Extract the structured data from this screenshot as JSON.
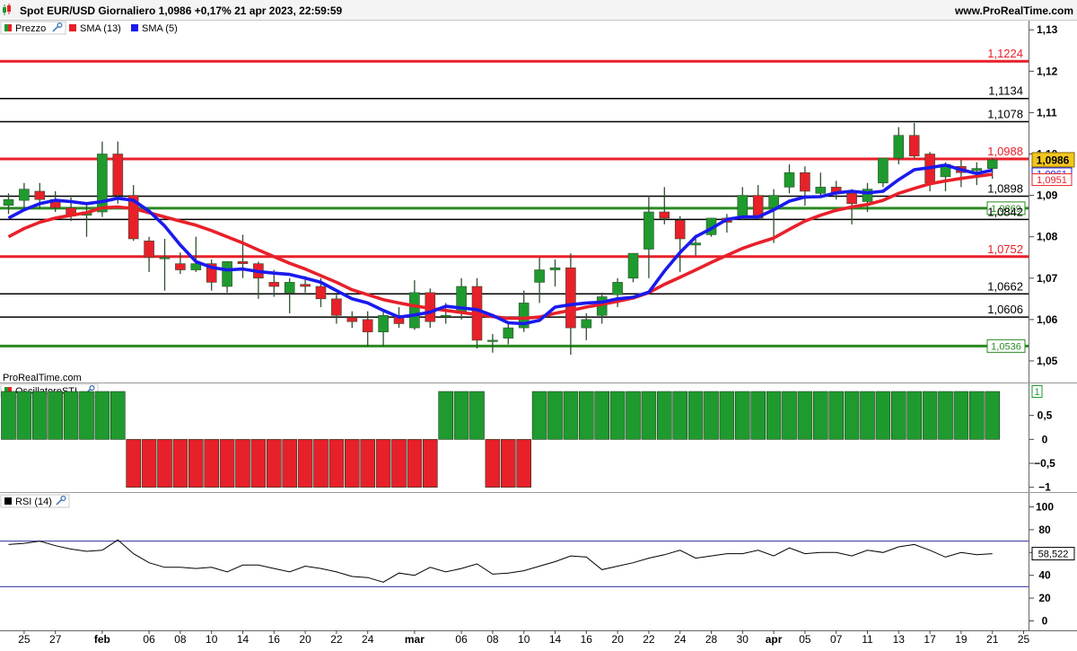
{
  "header": {
    "title": "Spot EUR/USD Giornaliero 1,0986 +0,17% 21 apr 2023, 22:59:59",
    "brand": "www.ProRealTime.com"
  },
  "legend": {
    "price": "Prezzo",
    "sma13": "SMA (13)",
    "sma5": "SMA (5)"
  },
  "watermark": "ProRealTime.com",
  "colors": {
    "bull": "#1f9a2e",
    "bear": "#e8202a",
    "sma13": "#e8202a",
    "sma5": "#1a1aee",
    "hline_red": "#e8202a",
    "hline_black": "#000000",
    "hline_green": "#2a8a20",
    "current": "#f2c61f"
  },
  "dates": [
    "2023-01-24",
    "2023-01-25",
    "2023-01-26",
    "2023-01-27",
    "2023-01-30",
    "2023-01-31",
    "2023-02-01",
    "2023-02-02",
    "2023-02-03",
    "2023-02-06",
    "2023-02-07",
    "2023-02-08",
    "2023-02-09",
    "2023-02-10",
    "2023-02-13",
    "2023-02-14",
    "2023-02-15",
    "2023-02-16",
    "2023-02-17",
    "2023-02-20",
    "2023-02-21",
    "2023-02-22",
    "2023-02-23",
    "2023-02-24",
    "2023-02-27",
    "2023-02-28",
    "2023-03-01",
    "2023-03-02",
    "2023-03-03",
    "2023-03-06",
    "2023-03-07",
    "2023-03-08",
    "2023-03-09",
    "2023-03-10",
    "2023-03-13",
    "2023-03-14",
    "2023-03-15",
    "2023-03-16",
    "2023-03-17",
    "2023-03-20",
    "2023-03-21",
    "2023-03-22",
    "2023-03-23",
    "2023-03-24",
    "2023-03-27",
    "2023-03-28",
    "2023-03-29",
    "2023-03-30",
    "2023-03-31",
    "2023-04-03",
    "2023-04-04",
    "2023-04-05",
    "2023-04-06",
    "2023-04-07",
    "2023-04-10",
    "2023-04-11",
    "2023-04-12",
    "2023-04-13",
    "2023-04-14",
    "2023-04-17",
    "2023-04-18",
    "2023-04-19",
    "2023-04-20",
    "2023-04-21"
  ],
  "x_labels": [
    {
      "date": "2023-01-25",
      "text": "25",
      "bold": false
    },
    {
      "date": "2023-01-27",
      "text": "27",
      "bold": false
    },
    {
      "date": "2023-02-01",
      "text": "feb",
      "bold": true
    },
    {
      "date": "2023-02-06",
      "text": "06",
      "bold": false
    },
    {
      "date": "2023-02-08",
      "text": "08",
      "bold": false
    },
    {
      "date": "2023-02-10",
      "text": "10",
      "bold": false
    },
    {
      "date": "2023-02-14",
      "text": "14",
      "bold": false
    },
    {
      "date": "2023-02-16",
      "text": "16",
      "bold": false
    },
    {
      "date": "2023-02-20",
      "text": "20",
      "bold": false
    },
    {
      "date": "2023-02-22",
      "text": "22",
      "bold": false
    },
    {
      "date": "2023-02-24",
      "text": "24",
      "bold": false
    },
    {
      "date": "2023-03-01",
      "text": "mar",
      "bold": true
    },
    {
      "date": "2023-03-06",
      "text": "06",
      "bold": false
    },
    {
      "date": "2023-03-08",
      "text": "08",
      "bold": false
    },
    {
      "date": "2023-03-10",
      "text": "10",
      "bold": false
    },
    {
      "date": "2023-03-14",
      "text": "14",
      "bold": false
    },
    {
      "date": "2023-03-16",
      "text": "16",
      "bold": false
    },
    {
      "date": "2023-03-20",
      "text": "20",
      "bold": false
    },
    {
      "date": "2023-03-22",
      "text": "22",
      "bold": false
    },
    {
      "date": "2023-03-24",
      "text": "24",
      "bold": false
    },
    {
      "date": "2023-03-28",
      "text": "28",
      "bold": false
    },
    {
      "date": "2023-03-30",
      "text": "30",
      "bold": false
    },
    {
      "date": "2023-04-03",
      "text": "apr",
      "bold": true
    },
    {
      "date": "2023-04-05",
      "text": "05",
      "bold": false
    },
    {
      "date": "2023-04-07",
      "text": "07",
      "bold": false
    },
    {
      "date": "2023-04-11",
      "text": "11",
      "bold": false
    },
    {
      "date": "2023-04-13",
      "text": "13",
      "bold": false
    },
    {
      "date": "2023-04-17",
      "text": "17",
      "bold": false
    },
    {
      "date": "2023-04-19",
      "text": "19",
      "bold": false
    },
    {
      "date": "2023-04-21",
      "text": "21",
      "bold": false
    },
    {
      "date": "2023-04-25",
      "text": "25",
      "bold": false
    }
  ],
  "chart_data": [
    {
      "type": "candlestick",
      "name": "Spot EUR/USD Giornaliero",
      "ylim": [
        1.045,
        1.132
      ],
      "y_ticks": [
        "1,05",
        "1,06",
        "1,07",
        "1,08",
        "1,09",
        "1,10",
        "1,11",
        "1,12",
        "1,13"
      ],
      "ohlc": [
        [
          1.0876,
          1.0905,
          1.0855,
          1.089
        ],
        [
          1.0888,
          1.093,
          1.0868,
          1.0915
        ],
        [
          1.091,
          1.093,
          1.0868,
          1.089
        ],
        [
          1.089,
          1.091,
          1.086,
          1.087
        ],
        [
          1.087,
          1.0895,
          1.0838,
          1.085
        ],
        [
          1.0852,
          1.0882,
          1.08,
          1.086
        ],
        [
          1.086,
          1.103,
          1.0848,
          1.1
        ],
        [
          1.1,
          1.103,
          1.088,
          1.09
        ],
        [
          1.09,
          1.0925,
          1.079,
          1.0795
        ],
        [
          1.079,
          1.08,
          1.0715,
          1.075
        ],
        [
          1.075,
          1.0795,
          1.067,
          1.075
        ],
        [
          1.0735,
          1.0762,
          1.071,
          1.072
        ],
        [
          1.072,
          1.08,
          1.0715,
          1.0735
        ],
        [
          1.0735,
          1.0745,
          1.067,
          1.069
        ],
        [
          1.068,
          1.074,
          1.0665,
          1.074
        ],
        [
          1.074,
          1.0805,
          1.07,
          1.0735
        ],
        [
          1.0735,
          1.074,
          1.065,
          1.07
        ],
        [
          1.069,
          1.072,
          1.0655,
          1.068
        ],
        [
          1.0665,
          1.07,
          1.0615,
          1.069
        ],
        [
          1.0685,
          1.0705,
          1.0665,
          1.068
        ],
        [
          1.068,
          1.07,
          1.063,
          1.065
        ],
        [
          1.065,
          1.066,
          1.059,
          1.061
        ],
        [
          1.0605,
          1.062,
          1.058,
          1.0595
        ],
        [
          1.06,
          1.062,
          1.0535,
          1.057
        ],
        [
          1.057,
          1.062,
          1.0535,
          1.061
        ],
        [
          1.061,
          1.063,
          1.058,
          1.059
        ],
        [
          1.058,
          1.0695,
          1.0575,
          1.0665
        ],
        [
          1.0665,
          1.0675,
          1.058,
          1.0595
        ],
        [
          1.061,
          1.064,
          1.059,
          1.061
        ],
        [
          1.062,
          1.07,
          1.06,
          1.068
        ],
        [
          1.068,
          1.07,
          1.053,
          1.055
        ],
        [
          1.055,
          1.0565,
          1.052,
          1.055
        ],
        [
          1.0555,
          1.059,
          1.054,
          1.058
        ],
        [
          1.058,
          1.067,
          1.057,
          1.064
        ],
        [
          1.069,
          1.075,
          1.064,
          1.072
        ],
        [
          1.072,
          1.0745,
          1.068,
          1.0725
        ],
        [
          1.0725,
          1.076,
          1.0515,
          1.058
        ],
        [
          1.058,
          1.0615,
          1.055,
          1.06
        ],
        [
          1.061,
          1.0665,
          1.059,
          1.0655
        ],
        [
          1.066,
          1.07,
          1.063,
          1.069
        ],
        [
          1.07,
          1.076,
          1.069,
          1.076
        ],
        [
          1.077,
          1.09,
          1.07,
          1.086
        ],
        [
          1.086,
          1.092,
          1.083,
          1.0845
        ],
        [
          1.084,
          1.085,
          1.0715,
          1.0795
        ],
        [
          1.078,
          1.0805,
          1.0755,
          1.0785
        ],
        [
          1.0805,
          1.0845,
          1.08,
          1.0845
        ],
        [
          1.0845,
          1.0855,
          1.081,
          1.0835
        ],
        [
          1.085,
          1.092,
          1.084,
          1.09
        ],
        [
          1.09,
          1.0925,
          1.0845,
          1.0845
        ],
        [
          1.087,
          1.0915,
          1.0785,
          1.09
        ],
        [
          1.092,
          1.0975,
          1.0905,
          1.0955
        ],
        [
          1.0955,
          1.097,
          1.0875,
          1.091
        ],
        [
          1.0905,
          1.0955,
          1.0895,
          1.092
        ],
        [
          1.092,
          1.0935,
          1.089,
          1.0905
        ],
        [
          1.0905,
          1.0915,
          1.083,
          1.088
        ],
        [
          1.0885,
          1.093,
          1.086,
          1.0915
        ],
        [
          1.093,
          1.099,
          1.092,
          1.099
        ],
        [
          1.099,
          1.1065,
          1.0975,
          1.1045
        ],
        [
          1.1045,
          1.1075,
          1.099,
          1.0995
        ],
        [
          1.1,
          1.1005,
          1.091,
          1.093
        ],
        [
          1.0945,
          1.098,
          1.091,
          1.0975
        ],
        [
          1.097,
          1.0985,
          1.092,
          1.0955
        ],
        [
          1.096,
          1.098,
          1.0925,
          1.0965
        ],
        [
          1.0965,
          1.099,
          1.094,
          1.0986
        ]
      ],
      "sma13": [
        1.08,
        1.082,
        1.0835,
        1.0845,
        1.0852,
        1.0858,
        1.087,
        1.0872,
        1.0868,
        1.0858,
        1.0848,
        1.0838,
        1.0828,
        1.0815,
        1.08,
        1.0785,
        1.0768,
        1.0752,
        1.0736,
        1.0722,
        1.0706,
        1.069,
        1.0672,
        1.066,
        1.0648,
        1.064,
        1.0633,
        1.0627,
        1.0622,
        1.0617,
        1.0612,
        1.0607,
        1.0603,
        1.0603,
        1.0606,
        1.0615,
        1.0622,
        1.063,
        1.0637,
        1.0644,
        1.0652,
        1.0665,
        1.0685,
        1.0702,
        1.072,
        1.0738,
        1.0755,
        1.0772,
        1.0785,
        1.0797,
        1.0818,
        1.0838,
        1.0852,
        1.0864,
        1.0872,
        1.0878,
        1.0888,
        1.0905,
        1.0917,
        1.0928,
        1.0935,
        1.0941,
        1.0946,
        1.0951
      ],
      "sma5": [
        1.0845,
        1.0865,
        1.088,
        1.0888,
        1.0885,
        1.088,
        1.0885,
        1.0893,
        1.0888,
        1.0862,
        1.0826,
        1.078,
        1.074,
        1.0726,
        1.072,
        1.0722,
        1.0716,
        1.0712,
        1.0709,
        1.07,
        1.069,
        1.067,
        1.065,
        1.064,
        1.0622,
        1.0606,
        1.0611,
        1.0618,
        1.0632,
        1.0628,
        1.0624,
        1.061,
        1.0592,
        1.059,
        1.0598,
        1.063,
        1.0636,
        1.064,
        1.0642,
        1.065,
        1.0654,
        1.0666,
        1.0717,
        1.0762,
        1.08,
        1.082,
        1.0842,
        1.0848,
        1.0848,
        1.0865,
        1.0886,
        1.0896,
        1.0897,
        1.0906,
        1.091,
        1.0906,
        1.091,
        1.0938,
        1.0962,
        1.0967,
        1.0973,
        1.0962,
        1.0953,
        1.0961
      ],
      "horizontal_levels": [
        {
          "value": 1.1224,
          "label": "1,1224",
          "color": "red",
          "boxed": false
        },
        {
          "value": 1.1134,
          "label": "1,1134",
          "color": "black",
          "boxed": false
        },
        {
          "value": 1.1078,
          "label": "1,1078",
          "color": "black",
          "boxed": false
        },
        {
          "value": 1.0988,
          "label": "1,0988",
          "color": "red",
          "boxed": false
        },
        {
          "value": 1.0898,
          "label": "1,0898",
          "color": "black",
          "boxed": false
        },
        {
          "value": 1.0869,
          "label": "1,0869",
          "color": "green",
          "boxed": true
        },
        {
          "value": 1.0842,
          "label": "1,0842",
          "color": "black",
          "boxed": false
        },
        {
          "value": 1.0752,
          "label": "1,0752",
          "color": "red",
          "boxed": false
        },
        {
          "value": 1.0662,
          "label": "1,0662",
          "color": "black",
          "boxed": false
        },
        {
          "value": 1.0606,
          "label": "1,0606",
          "color": "black",
          "boxed": false
        },
        {
          "value": 1.0536,
          "label": "1,0536",
          "color": "green",
          "boxed": true
        }
      ],
      "axis_badges": [
        {
          "value": 1.0986,
          "label": "1,0986",
          "kind": "current"
        },
        {
          "value": 1.0961,
          "label": "1,0961",
          "kind": "sma5"
        },
        {
          "value": 1.0951,
          "label": "1,0951",
          "kind": "sma13"
        }
      ]
    },
    {
      "type": "bar",
      "name": "OscillatoreSTI",
      "ylim": [
        -1.1,
        1.15
      ],
      "y_ticks": [
        {
          "value": 0.5,
          "label": "0,5"
        },
        {
          "value": 0,
          "label": "0"
        },
        {
          "value": -0.5,
          "label": "−0,5"
        },
        {
          "value": -1,
          "label": "−1"
        }
      ],
      "values": [
        1,
        1,
        1,
        1,
        1,
        1,
        1,
        1,
        -1,
        -1,
        -1,
        -1,
        -1,
        -1,
        -1,
        -1,
        -1,
        -1,
        -1,
        -1,
        -1,
        -1,
        -1,
        -1,
        -1,
        -1,
        -1,
        -1,
        1,
        1,
        1,
        -1,
        -1,
        -1,
        1,
        1,
        1,
        1,
        1,
        1,
        1,
        1,
        1,
        1,
        1,
        1,
        1,
        1,
        1,
        1,
        1,
        1,
        1,
        1,
        1,
        1,
        1,
        1,
        1,
        1,
        1,
        1,
        1,
        1
      ],
      "current_label": "1"
    },
    {
      "type": "line",
      "name": "RSI (14)",
      "ylim": [
        0,
        100
      ],
      "y_ticks": [
        {
          "value": 100,
          "label": "100"
        },
        {
          "value": 80,
          "label": "80"
        },
        {
          "value": 60,
          "label": "60"
        },
        {
          "value": 40,
          "label": "40"
        },
        {
          "value": 20,
          "label": "20"
        },
        {
          "value": 0,
          "label": "0"
        }
      ],
      "bands": [
        70,
        30
      ],
      "values": [
        67,
        68,
        70,
        66,
        63,
        61,
        62,
        71,
        59,
        51,
        47,
        47,
        46,
        47,
        43,
        49,
        49,
        46,
        43,
        48,
        46,
        43,
        39,
        38,
        34,
        42,
        40,
        47,
        43,
        46,
        50,
        41,
        42,
        44,
        48,
        52,
        57,
        56,
        45,
        48,
        51,
        55,
        58,
        62,
        55,
        57,
        59,
        59,
        62,
        57,
        64,
        59,
        60,
        60,
        57,
        62,
        60,
        65,
        67,
        62,
        56,
        60,
        58,
        59
      ],
      "current_label": "58,522"
    }
  ]
}
